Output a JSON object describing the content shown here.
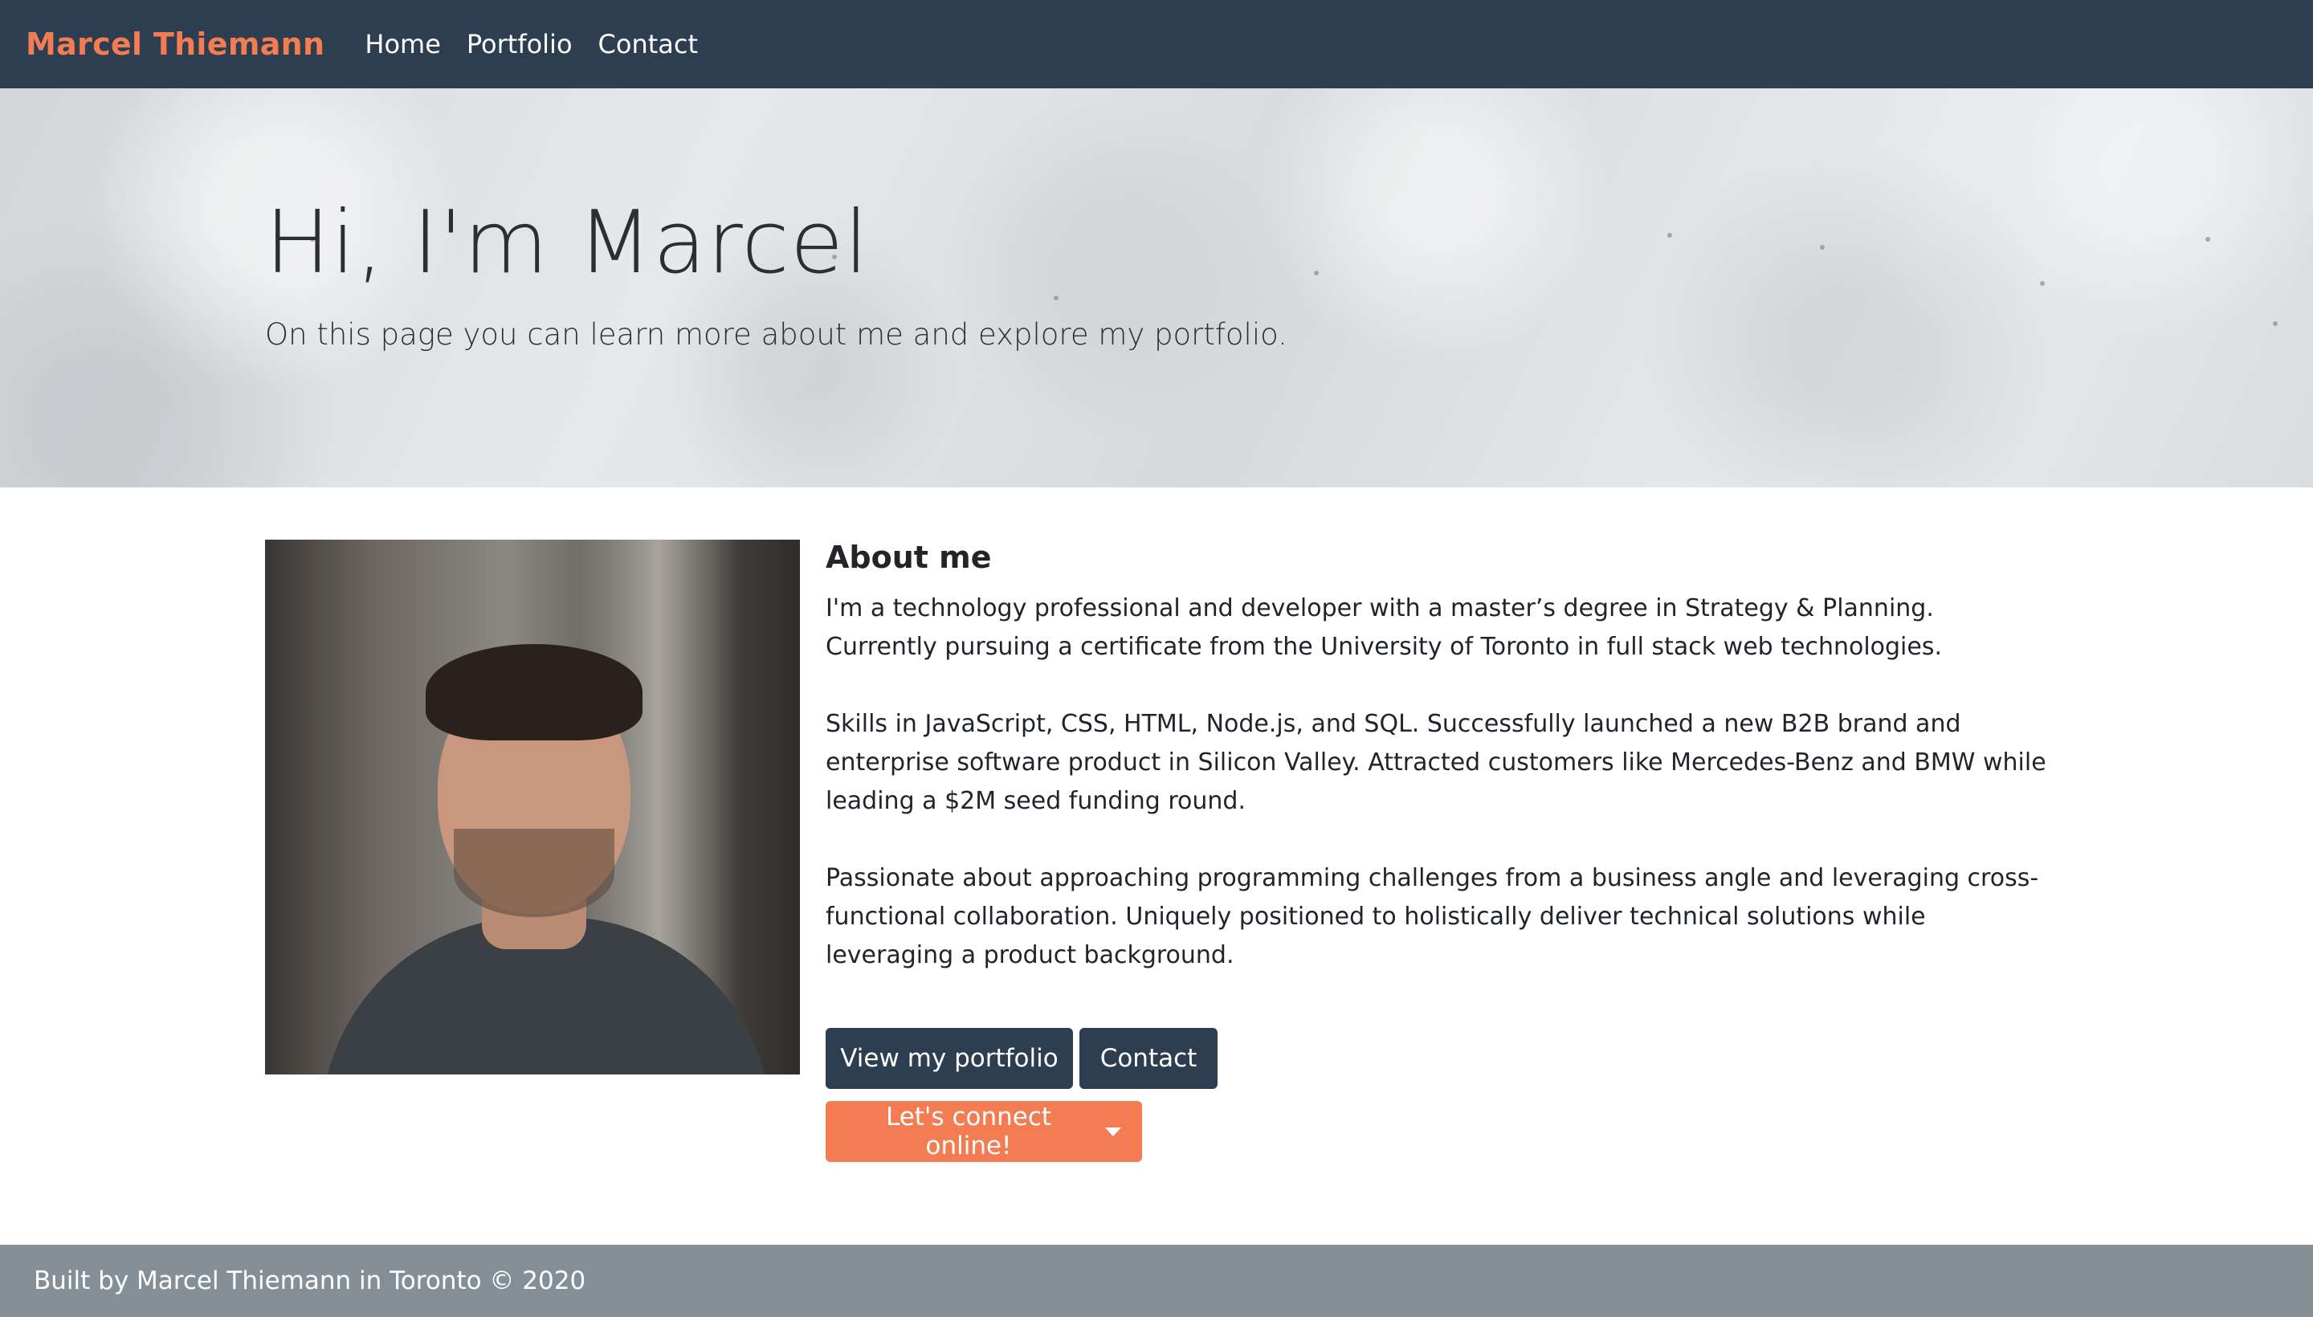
{
  "navbar": {
    "brand": "Marcel Thiemann",
    "links": [
      "Home",
      "Portfolio",
      "Contact"
    ]
  },
  "hero": {
    "title": "Hi, I'm Marcel",
    "subtitle": "On this page you can learn more about me and explore my portfolio."
  },
  "about": {
    "title": "About me",
    "paragraphs": [
      "I'm a technology professional and developer with a master’s degree in Strategy & Planning. Currently pursuing a certificate from the University of Toronto in full stack web technologies.",
      "Skills in JavaScript, CSS, HTML, Node.js, and SQL. Successfully launched a new B2B brand and enterprise software product in Silicon Valley. Attracted customers like Mercedes-Benz and BMW while leading a $2M seed funding round.",
      "Passionate about approaching programming challenges from a business angle and leveraging cross-functional collaboration. Uniquely positioned to holistically deliver technical solutions while leveraging a product background."
    ]
  },
  "buttons": {
    "portfolio": "View my portfolio",
    "contact": "Contact",
    "connect": "Let's connect online!"
  },
  "footer": {
    "text": "Built by Marcel Thiemann in Toronto © 2020"
  },
  "colors": {
    "navbar": "#2c3e50",
    "brand_accent": "#f47c52",
    "footer": "#848f98"
  },
  "icons": {
    "connect_dropdown": "caret-down-icon"
  }
}
